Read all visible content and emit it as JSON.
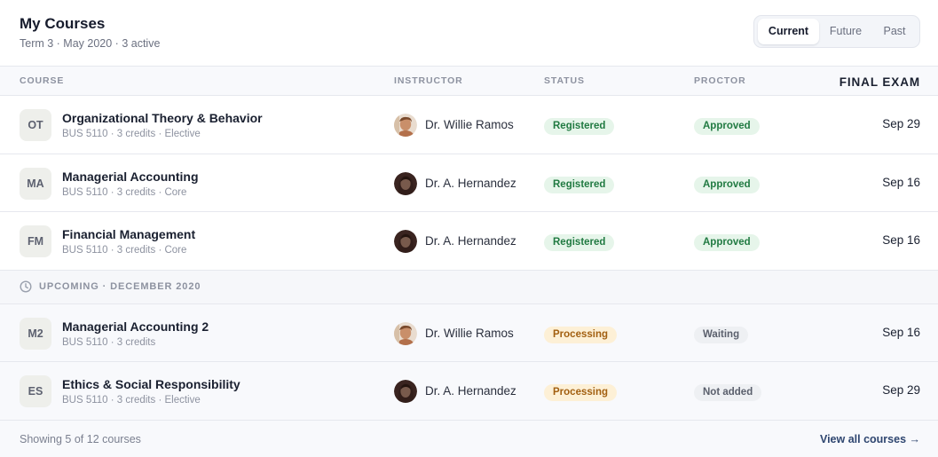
{
  "header": {
    "title": "My Courses",
    "subtitle": "Term 3 · May 2020 · 3 active",
    "tabs": [
      "Current",
      "Future",
      "Past"
    ],
    "active_tab": "Current"
  },
  "columns": {
    "course": "COURSE",
    "instructor": "INSTRUCTOR",
    "status": "STATUS",
    "proctor": "PROCTOR",
    "final_exam": "FINAL EXAM"
  },
  "current_courses": [
    {
      "initials": "OT",
      "name": "Organizational Theory & Behavior",
      "meta": "BUS 5110 · 3 credits · Elective",
      "instructor": "Dr. Willie Ramos",
      "status": "Registered",
      "proctor": "Approved",
      "exam": "Sep 29"
    },
    {
      "initials": "MA",
      "name": "Managerial Accounting",
      "meta": "BUS 5110 · 3 credits · Core",
      "instructor": "Dr. A. Hernandez",
      "status": "Registered",
      "proctor": "Approved",
      "exam": "Sep 16"
    },
    {
      "initials": "FM",
      "name": "Financial Management",
      "meta": "BUS 5110 · 3 credits · Core",
      "instructor": "Dr. A. Hernandez",
      "status": "Registered",
      "proctor": "Approved",
      "exam": "Sep 16"
    }
  ],
  "upcoming_group_label": "UPCOMING · DECEMBER 2020",
  "upcoming_courses": [
    {
      "initials": "M2",
      "name": "Managerial Accounting 2",
      "meta": "BUS 5110 · 3 credits",
      "instructor": "Dr. Willie Ramos",
      "status": "Processing",
      "proctor": "Waiting",
      "exam": "Sep 16"
    },
    {
      "initials": "ES",
      "name": "Ethics & Social Responsibility",
      "meta": "BUS 5110 · 3 credits · Elective",
      "instructor": "Dr. A. Hernandez",
      "status": "Processing",
      "proctor": "Not added",
      "exam": "Sep 29"
    }
  ],
  "footer": {
    "showing": "Showing 5 of 12 courses",
    "view_all": "View all courses →"
  },
  "colors": {
    "registered_bg": "#e6f5ea",
    "registered_text": "#217a42",
    "processing_bg": "#fdf0d6",
    "processing_text": "#a25f10",
    "neutral_bg": "#eef0f3",
    "link": "#2f4670"
  },
  "icons": {
    "group": "clock-icon",
    "instructor_photo": "instructor-avatar"
  }
}
